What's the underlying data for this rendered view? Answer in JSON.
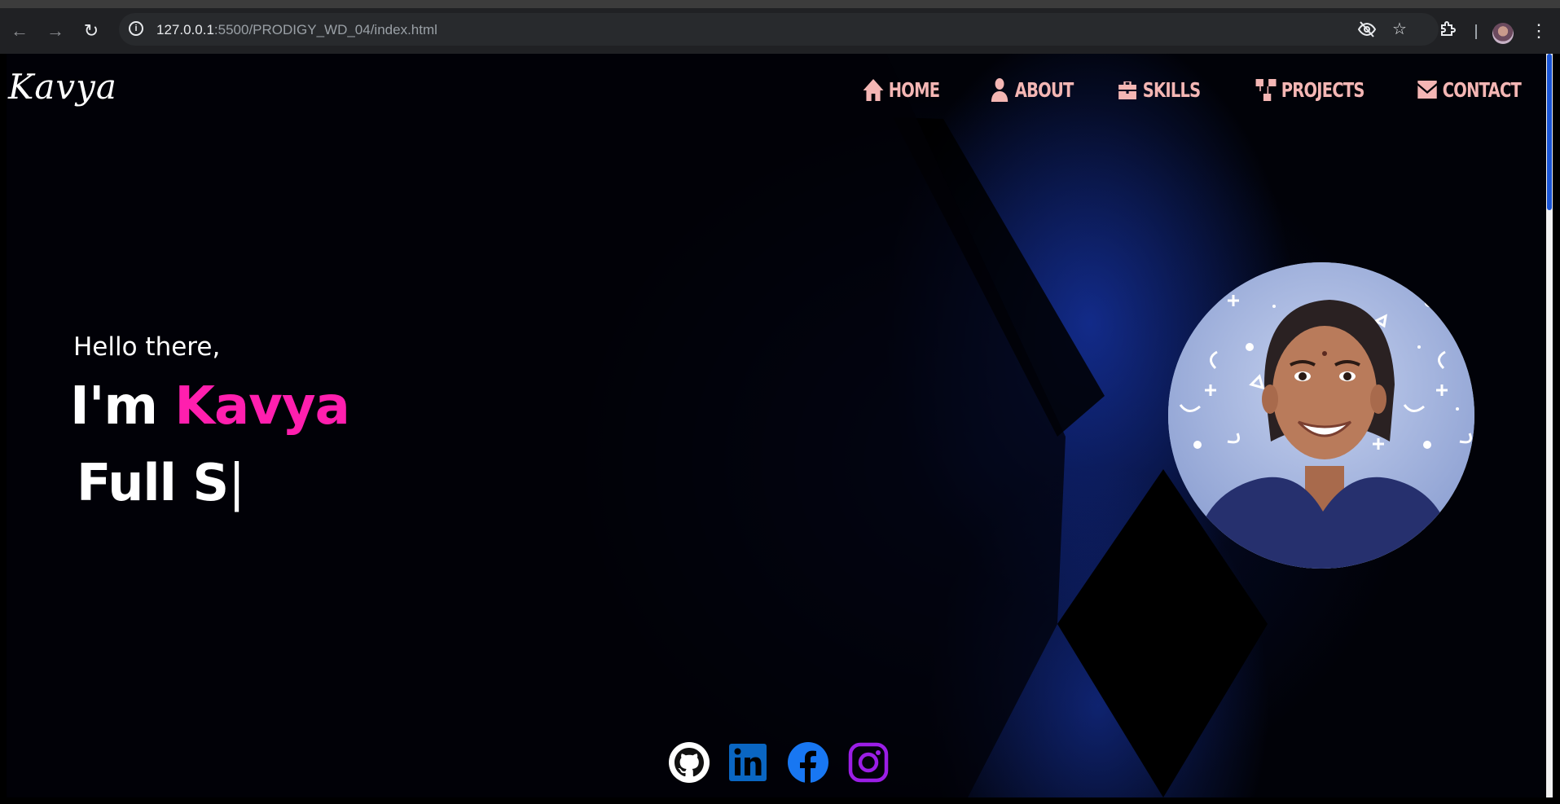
{
  "browser": {
    "url_host": "127.0.0.1",
    "url_rest": ":5500/PRODIGY_WD_04/index.html",
    "icons": [
      "back-icon",
      "forward-icon",
      "reload-icon",
      "site-info-icon",
      "eye-off-icon",
      "star-icon",
      "extensions-icon",
      "profile-avatar",
      "menu-icon"
    ]
  },
  "header": {
    "logo": "Kavya",
    "nav": [
      {
        "label": "HOME",
        "icon": "home-icon"
      },
      {
        "label": "ABOUT",
        "icon": "user-icon"
      },
      {
        "label": "SKILLS",
        "icon": "toolbox-icon"
      },
      {
        "label": "PROJECTS",
        "icon": "sitemap-icon"
      },
      {
        "label": "CONTACT",
        "icon": "envelope-icon"
      }
    ]
  },
  "hero": {
    "greeting": "Hello there,",
    "name_prefix": "I'm ",
    "name_highlight": "Kavya",
    "typed": "Full S",
    "cursor": "|"
  },
  "socials": [
    {
      "name": "github-icon",
      "color": "#ffffff"
    },
    {
      "name": "linkedin-icon",
      "color": "#0a66c2"
    },
    {
      "name": "facebook-icon",
      "color": "#1877f2"
    },
    {
      "name": "instagram-icon",
      "color": "#9b1ee6"
    }
  ],
  "colors": {
    "accent_pink": "#ff1fae",
    "nav_pink": "#f4b6b4",
    "glow_blue": "#1e46dc",
    "scroll_thumb": "#1a55d6"
  }
}
